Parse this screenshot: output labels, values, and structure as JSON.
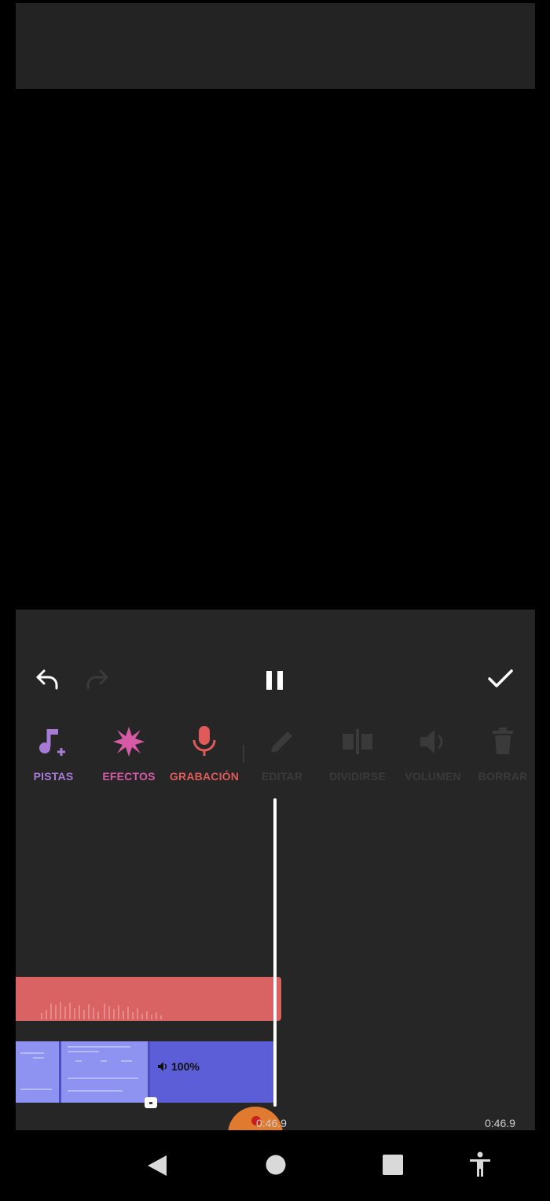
{
  "toolbar": {
    "undo_icon": "undo-icon",
    "redo_icon": "redo-icon",
    "pause_icon": "pause-icon",
    "confirm_icon": "check-icon"
  },
  "tools": [
    {
      "label": "PISTAS",
      "icon": "music-add-icon",
      "color": "#a77ad6",
      "enabled": true
    },
    {
      "label": "EFECTOS",
      "icon": "burst-icon",
      "color": "#d65aa6",
      "enabled": true
    },
    {
      "label": "GRABACIÓN",
      "icon": "microphone-icon",
      "color": "#e05a5a",
      "enabled": true
    },
    {
      "label": "EDITAR",
      "icon": "pencil-icon",
      "color": "#3a3a3a",
      "enabled": false
    },
    {
      "label": "DIVIDIRSE",
      "icon": "split-icon",
      "color": "#3a3a3a",
      "enabled": false
    },
    {
      "label": "VOLUMEN",
      "icon": "volume-icon",
      "color": "#3a3a3a",
      "enabled": false
    },
    {
      "label": "BORRAR",
      "icon": "trash-icon",
      "color": "#3a3a3a",
      "enabled": false
    }
  ],
  "timeline": {
    "video_volume": "100%",
    "current_time": "0:46.9",
    "total_time": "0:46.9"
  },
  "colors": {
    "audio_track": "#d96363",
    "video_track": "#5b5ed6",
    "record_button": "#e07a2f"
  },
  "navbar": {
    "back_icon": "back-triangle-icon",
    "home_icon": "home-circle-icon",
    "recents_icon": "recents-square-icon",
    "accessibility_icon": "accessibility-icon"
  }
}
